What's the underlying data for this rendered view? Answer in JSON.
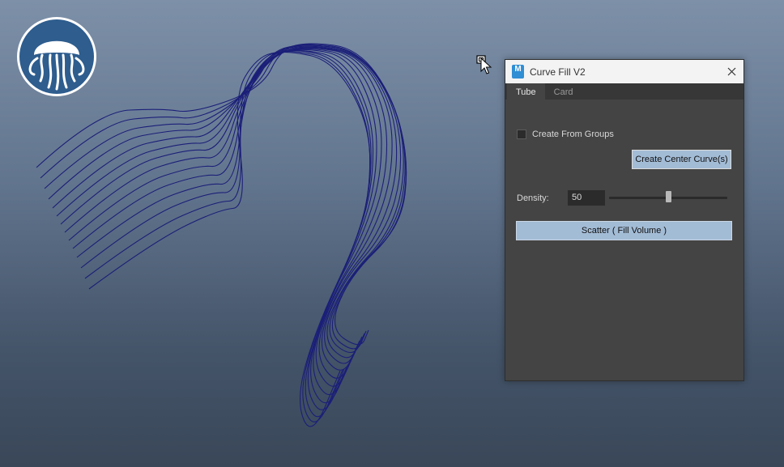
{
  "window": {
    "title": "Curve Fill V2",
    "app_icon_letter": "M",
    "app_icon_color": "#2f8ed4"
  },
  "tabs": [
    {
      "label": "Tube",
      "active": true
    },
    {
      "label": "Card",
      "active": false
    }
  ],
  "tube": {
    "create_from_groups_label": "Create From Groups",
    "create_from_groups_checked": false,
    "create_center_button": "Create Center Curve(s)",
    "density_label": "Density:",
    "density_value": "50",
    "density_slider_fraction": 0.5,
    "scatter_button": "Scatter ( Fill Volume )"
  },
  "colors": {
    "button_accent": "#a3bcd6",
    "panel_bg": "#444444",
    "curve_color": "#1b1f78"
  },
  "icons": [
    "jellyfish-logo-icon",
    "app-icon",
    "close-icon",
    "mouse-cursor-icon",
    "checkbox-icon"
  ]
}
